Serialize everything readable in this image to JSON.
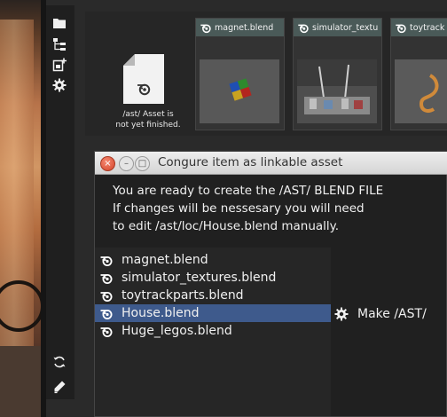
{
  "colors": {
    "selection": "#3e5a8c",
    "card_bar": "#4a5a58",
    "close_button": "#d4432a"
  },
  "toolbar": {
    "items": [
      {
        "name": "folder-icon"
      },
      {
        "name": "outliner-tree-icon"
      },
      {
        "name": "add-asset-icon"
      },
      {
        "name": "gear-icon"
      },
      {
        "name": "refresh-icon"
      },
      {
        "name": "pencil-icon"
      }
    ]
  },
  "browser": {
    "placeholder": {
      "line1": "/ast/ Asset is",
      "line2": "not yet finished."
    },
    "cards": [
      {
        "label": "magnet.blend"
      },
      {
        "label": "simulator_textu"
      },
      {
        "label": "toytrack"
      }
    ]
  },
  "dialog": {
    "title": "Congure item as linkable asset",
    "message": [
      "You are ready to create the /AST/ BLEND FILE",
      "If changes will be nessesary you will need",
      "to edit /ast/loc/House.blend manually."
    ],
    "files": [
      {
        "label": "magnet.blend",
        "selected": false
      },
      {
        "label": "simulator_textures.blend",
        "selected": false
      },
      {
        "label": "toytrackparts.blend",
        "selected": false
      },
      {
        "label": "House.blend",
        "selected": true
      },
      {
        "label": "Huge_legos.blend",
        "selected": false
      }
    ],
    "make_label": "Make /AST/"
  }
}
